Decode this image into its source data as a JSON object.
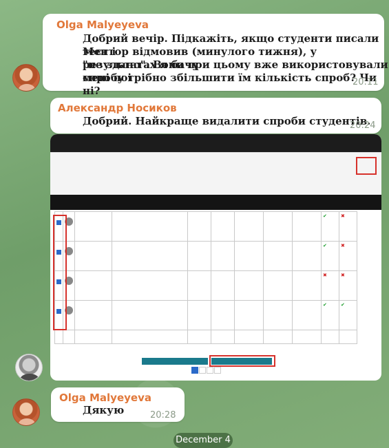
{
  "messages": [
    {
      "sender": "Olga Malyeyeva",
      "lines": [
        "Добрий вечір. Підкажіть, якщо студенти писали тест і",
        "Ментор відмовив (минулого тижня), у результатах я бачу",
        "\"не здано\". Вони при цьому вже використовували спробу і",
        "мені потрібно збільшити їм кількість спроб? Чи ні?"
      ],
      "time": "20:11"
    },
    {
      "sender": "Александр Носиков",
      "lines": [
        "Добрий. Найкраще видалити спроби  студентів."
      ],
      "time": "20:24"
    },
    {
      "sender": "Olga Malyeyeva",
      "lines": [
        "Дякую"
      ],
      "time": "20:28"
    }
  ],
  "date_separator": "December 4",
  "colors": {
    "sender": "#e1783a",
    "background": "#7aa873",
    "highlight_box": "#d6312b"
  },
  "icons": {
    "olga_avatar": "avatar-olga",
    "alex_avatar": "avatar-alex"
  }
}
